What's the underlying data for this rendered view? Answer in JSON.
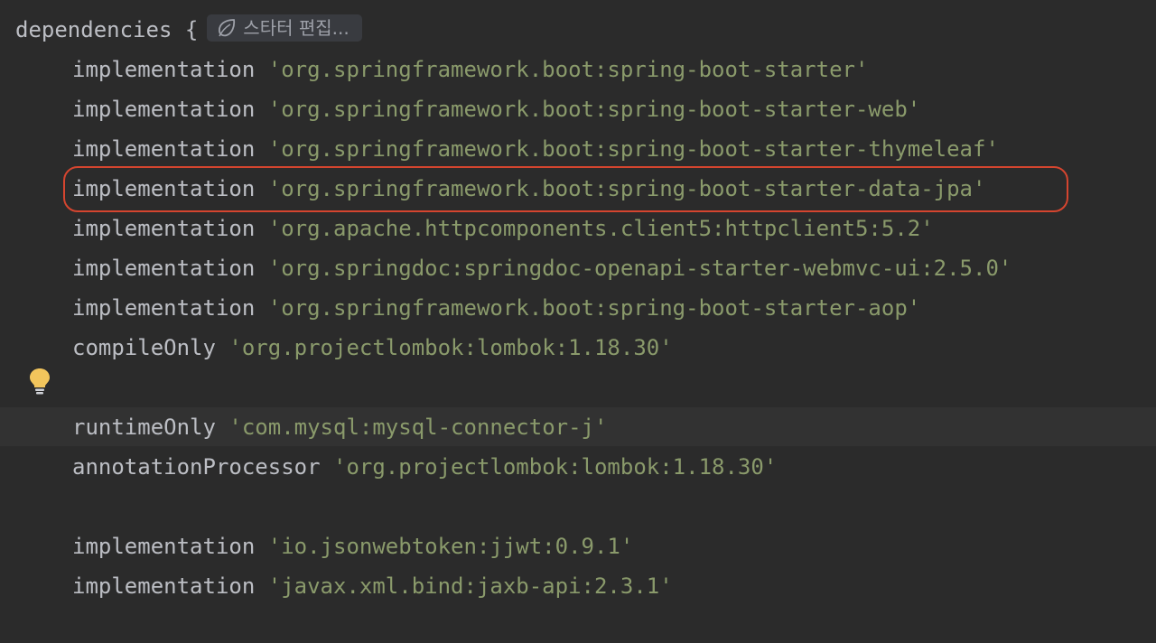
{
  "editor": {
    "block_keyword": "dependencies",
    "open_brace": "{",
    "starter_chip": {
      "icon": "spring-leaf-icon",
      "label": "스타터 편집..."
    },
    "lines": [
      {
        "keyword": "implementation",
        "value": "'org.springframework.boot:spring-boot-starter'"
      },
      {
        "keyword": "implementation",
        "value": "'org.springframework.boot:spring-boot-starter-web'"
      },
      {
        "keyword": "implementation",
        "value": "'org.springframework.boot:spring-boot-starter-thymeleaf'"
      },
      {
        "keyword": "implementation",
        "value": "'org.springframework.boot:spring-boot-starter-data-jpa'"
      },
      {
        "keyword": "implementation",
        "value": "'org.apache.httpcomponents.client5:httpclient5:5.2'"
      },
      {
        "keyword": "implementation",
        "value": "'org.springdoc:springdoc-openapi-starter-webmvc-ui:2.5.0'"
      },
      {
        "keyword": "implementation",
        "value": "'org.springframework.boot:spring-boot-starter-aop'"
      },
      {
        "keyword": "compileOnly",
        "value": "'org.projectlombok:lombok:1.18.30'"
      },
      {
        "keyword": "runtimeOnly",
        "value": "'com.mysql:mysql-connector-j'"
      },
      {
        "keyword": "annotationProcessor",
        "value": "'org.projectlombok:lombok:1.18.30'"
      },
      {
        "keyword": "implementation",
        "value": "'io.jsonwebtoken:jjwt:0.9.1'"
      },
      {
        "keyword": "implementation",
        "value": "'javax.xml.bind:jaxb-api:2.3.1'"
      }
    ],
    "gutter_icon": "lightbulb-icon"
  },
  "colors": {
    "background": "#2b2b2b",
    "current_line": "#323232",
    "keyword": "#bcbec4",
    "string": "#8a9a6b",
    "highlight": "#d5452f",
    "bulb": "#f2c55c"
  }
}
